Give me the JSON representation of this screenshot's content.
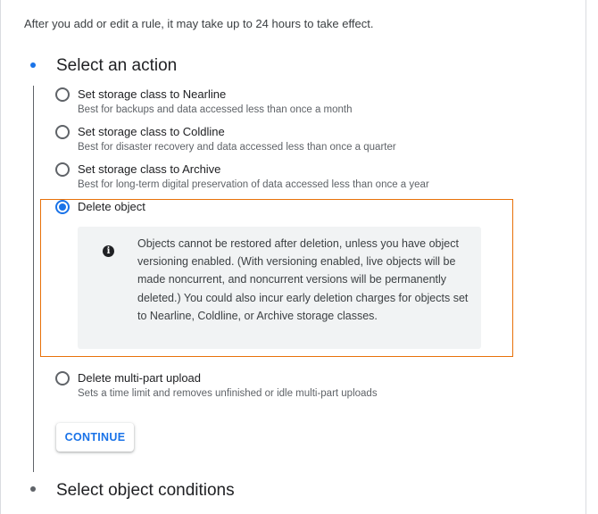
{
  "notice": "After you add or edit a rule, it may take up to 24 hours to take effect.",
  "steps": [
    {
      "title": "Select an action",
      "state": "active"
    },
    {
      "title": "Select object conditions",
      "state": "inactive"
    }
  ],
  "options": [
    {
      "label": "Set storage class to Nearline",
      "description": "Best for backups and data accessed less than once a month",
      "selected": false
    },
    {
      "label": "Set storage class to Coldline",
      "description": "Best for disaster recovery and data accessed less than once a quarter",
      "selected": false
    },
    {
      "label": "Set storage class to Archive",
      "description": "Best for long-term digital preservation of data accessed less than once a year",
      "selected": false
    },
    {
      "label": "Delete object",
      "description": "",
      "selected": true
    },
    {
      "label": "Delete multi-part upload",
      "description": "Sets a time limit and removes unfinished or idle multi-part uploads",
      "selected": false
    }
  ],
  "info": {
    "icon": "info-icon",
    "text": "Objects cannot be restored after deletion, unless you have object versioning enabled. (With versioning enabled, live objects will be made noncurrent, and noncurrent versions will be permanently deleted.) You could also incur early deletion charges for objects set to Nearline, Coldline, or Archive storage classes."
  },
  "continue_label": "CONTINUE",
  "colors": {
    "accent": "#1a73e8",
    "highlight": "#e8710a"
  }
}
